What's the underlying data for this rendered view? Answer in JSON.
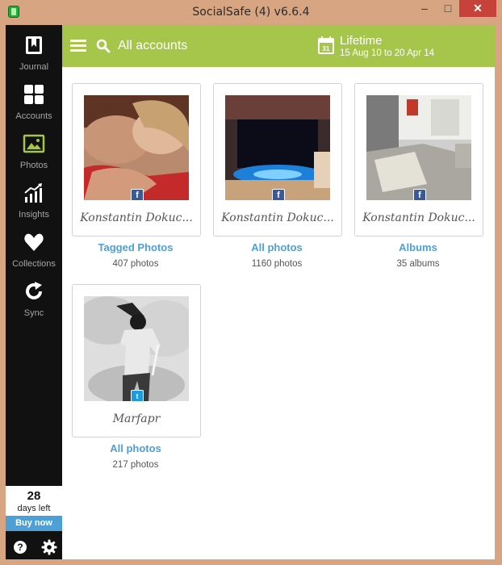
{
  "window": {
    "title": "SocialSafe (4) v6.6.4",
    "minimize": "–",
    "maximize": "□",
    "close": "✕"
  },
  "sidebar": {
    "items": [
      {
        "label": "Journal",
        "icon": "journal-icon",
        "active": false
      },
      {
        "label": "Accounts",
        "icon": "accounts-grid-icon",
        "active": false
      },
      {
        "label": "Photos",
        "icon": "photos-icon",
        "active": true
      },
      {
        "label": "Insights",
        "icon": "insights-chart-icon",
        "active": false
      },
      {
        "label": "Collections",
        "icon": "heart-icon",
        "active": false
      },
      {
        "label": "Sync",
        "icon": "sync-icon",
        "active": false
      }
    ],
    "trial": {
      "days": "28",
      "days_label": "days left",
      "buy": "Buy now"
    },
    "help": "?"
  },
  "topbar": {
    "accounts": "All accounts",
    "period": "Lifetime",
    "range": "15 Aug 10 to 20 Apr 14",
    "calendar_day": "31"
  },
  "cards": [
    {
      "name": "Konstantin Dokuc...",
      "network": "facebook",
      "badge": "f",
      "title": "Tagged Photos",
      "count": "407 photos"
    },
    {
      "name": "Konstantin Dokuc...",
      "network": "facebook",
      "badge": "f",
      "title": "All photos",
      "count": "1160 photos"
    },
    {
      "name": "Konstantin Dokuc...",
      "network": "facebook",
      "badge": "f",
      "title": "Albums",
      "count": "35 albums"
    },
    {
      "name": "Marfapr",
      "network": "twitter",
      "badge": "t",
      "title": "All photos",
      "count": "217 photos"
    }
  ],
  "colors": {
    "accent_green": "#a6c64b",
    "link_blue": "#4d9fd8",
    "sidebar_bg": "#111111",
    "facebook": "#3b5998",
    "twitter": "#1c9be0"
  }
}
